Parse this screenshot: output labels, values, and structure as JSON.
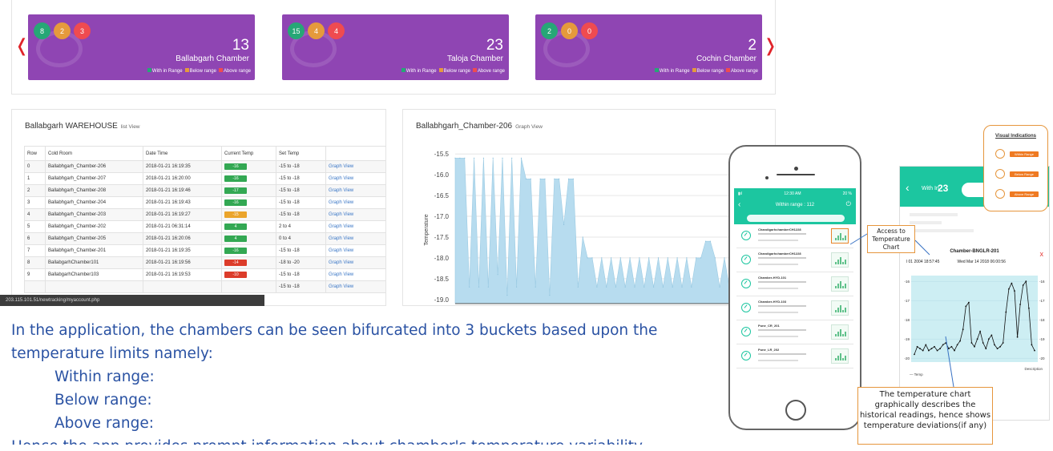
{
  "dashboard": {
    "prev_arrow": "❬",
    "next_arrow": "❭",
    "legend": {
      "within": "With in Range",
      "below": "Below range",
      "above": "Above range"
    },
    "colors": {
      "card_bg": "#8f45b3",
      "within": "#26a776",
      "below": "#e59a3c",
      "above": "#ef4b50"
    },
    "cards": [
      {
        "within": "8",
        "below": "2",
        "above": "3",
        "total": "13",
        "name": "Ballabgarh Chamber"
      },
      {
        "within": "15",
        "below": "4",
        "above": "4",
        "total": "23",
        "name": "Taloja Chamber"
      },
      {
        "within": "2",
        "below": "0",
        "above": "0",
        "total": "2",
        "name": "Cochin Chamber"
      }
    ],
    "warehouse": {
      "title": "Ballabgarh WAREHOUSE",
      "view": "list View",
      "headers": [
        "Row",
        "Cold Room",
        "Date Time",
        "Current Temp",
        "Set Temp",
        ""
      ],
      "rows": [
        {
          "row": "0",
          "room": "Ballabhgarh_Chamber-206",
          "time": "2018-01-21 16:19:35",
          "temp": "-16",
          "status": "g",
          "set": "-15 to -18",
          "link": "Graph View"
        },
        {
          "row": "1",
          "room": "Ballabhgarh_Chamber-207",
          "time": "2018-01-21 16:20:00",
          "temp": "-16",
          "status": "g",
          "set": "-15 to -18",
          "link": "Graph View"
        },
        {
          "row": "2",
          "room": "Ballabhgarh_Chamber-208",
          "time": "2018-01-21 16:19:46",
          "temp": "-17",
          "status": "g",
          "set": "-15 to -18",
          "link": "Graph View"
        },
        {
          "row": "3",
          "room": "Ballabhgarh_Chamber-204",
          "time": "2018-01-21 16:19:43",
          "temp": "-16",
          "status": "g",
          "set": "-15 to -18",
          "link": "Graph View"
        },
        {
          "row": "4",
          "room": "Ballabhgarh_Chamber-203",
          "time": "2018-01-21 16:19:27",
          "temp": "-15",
          "status": "o",
          "set": "-15 to -18",
          "link": "Graph View"
        },
        {
          "row": "5",
          "room": "Ballabhgarh_Chamber-202",
          "time": "2018-01-21 06:31:14",
          "temp": "4",
          "status": "g",
          "set": "2 to 4",
          "link": "Graph View"
        },
        {
          "row": "6",
          "room": "Ballabhgarh_Chamber-205",
          "time": "2018-01-21 16:20:06",
          "temp": "4",
          "status": "g",
          "set": "0 to 4",
          "link": "Graph View"
        },
        {
          "row": "7",
          "room": "Ballabhgarh_Chamber-201",
          "time": "2018-01-21 16:19:35",
          "temp": "-16",
          "status": "g",
          "set": "-15 to -18",
          "link": "Graph View"
        },
        {
          "row": "8",
          "room": "BallabgarhChamber101",
          "time": "2018-01-21 16:19:56",
          "temp": "-14",
          "status": "r",
          "set": "-18 to -20",
          "link": "Graph View"
        },
        {
          "row": "9",
          "room": "BallabgarhChamber103",
          "time": "2018-01-21 16:19:53",
          "temp": "-10",
          "status": "r",
          "set": "-15 to -18",
          "link": "Graph View"
        },
        {
          "row": "",
          "room": "",
          "time": "",
          "temp": "",
          "status": "",
          "set": "-15 to -18",
          "link": "Graph View"
        }
      ]
    },
    "status_url": "203.115.101.51/newtracking/myaccount.php",
    "graph": {
      "title": "Ballabhgarh_Chamber-206",
      "view": "Graph View"
    }
  },
  "chart_data": [
    {
      "type": "area",
      "title": "Ballabhgarh_Chamber-206",
      "ylabel": "Temperature",
      "xlabel": "",
      "ylim": [
        -19.1,
        -15.4
      ],
      "yticks": [
        "-15.5",
        "-16.0",
        "-16.5",
        "-17.0",
        "-17.5",
        "-18.0",
        "-18.5",
        "-19.0"
      ],
      "series": [
        {
          "values": [
            -15.6,
            -15.6,
            -15.6,
            -18.7,
            -15.6,
            -18.7,
            -15.6,
            -18.7,
            -15.6,
            -18.4,
            -15.6,
            -18.9,
            -15.6,
            -18.7,
            -15.6,
            -16.1,
            -16.1,
            -18.7,
            -16.1,
            -16.1,
            -18.9,
            -16.1,
            -16.1,
            -17.2,
            -16.1,
            -16.1,
            -18.7,
            -17.5,
            -18.0,
            -18.0,
            -18.7,
            -18.0,
            -18.7,
            -18.0,
            -18.7,
            -18.0,
            -18.7,
            -18.0,
            -18.7,
            -18.0,
            -18.7,
            -18.0,
            -18.7,
            -18.0,
            -18.7,
            -18.0,
            -18.7,
            -18.0,
            -18.7,
            -18.0,
            -18.7,
            -18.0,
            -18.0,
            -17.6,
            -17.6,
            -18.0,
            -18.7,
            -18.0,
            -18.7,
            -18.0,
            -18.7,
            -18.0,
            -18.7,
            -18.0,
            -18.7,
            -18.0,
            -18.7,
            -18.0
          ]
        }
      ]
    },
    {
      "type": "line",
      "title": "Chamber-BNGLR-201",
      "xlabel": "Description",
      "ylabel": "",
      "ylim": [
        -20.2,
        -15.7
      ],
      "yticks": [
        "-16",
        "-17",
        "-18",
        "-19",
        "-20"
      ],
      "series": [
        {
          "name": "Temp",
          "values": [
            -19.8,
            -19.4,
            -19.5,
            -19.6,
            -19.3,
            -19.6,
            -19.5,
            -19.4,
            -19.6,
            -19.5,
            -19.3,
            -19.2,
            -19.5,
            -19.4,
            -19.6,
            -19.3,
            -19.1,
            -18.5,
            -17.3,
            -17.1,
            -19.2,
            -19.4,
            -19.0,
            -18.6,
            -19.2,
            -19.5,
            -19.0,
            -18.8,
            -19.3,
            -19.5,
            -19.4,
            -19.2,
            -17.6,
            -16.4,
            -16.1,
            -16.5,
            -18.9,
            -17.2,
            -16.2,
            -16.0,
            -17.4,
            -19.3,
            -19.6
          ]
        }
      ]
    }
  ],
  "description": {
    "line1": "In the application, the chambers can be seen bifurcated into 3 buckets based upon the",
    "line2": "temperature limits namely:",
    "within": "Within range:",
    "below": "Below range:",
    "above": "Above range:",
    "line6": "Hence the app provides prompt information about chamber's temperature variability"
  },
  "phone": {
    "time": "12:30 AM",
    "battery": "20 %",
    "title": "Within range : 112",
    "items": [
      {
        "name": "ChandigarhchamberCH1228"
      },
      {
        "name": "ChandigarhchamberCH1228"
      },
      {
        "name": "Chamber-HYD-101"
      },
      {
        "name": "Chamber-HYD-103"
      },
      {
        "name": "Pune_CR_201"
      },
      {
        "name": "Pune_LR_202"
      }
    ]
  },
  "callouts": {
    "access": "Access to Temperature Chart",
    "temp_chart": "The temperature chart graphically describes the historical readings, hence shows temperature deviations(if any)"
  },
  "android": {
    "status_time": "12:34 PM",
    "within_label": "With In",
    "within_count": "23",
    "chart_title": "Chamber-BNGLR-201",
    "date_from": "l 01 2004 18:57:45",
    "date_to": "Wed Mar 14 2018 06:00:56",
    "legend": "— Temp",
    "close": "x"
  },
  "visual_indications": {
    "title": "Visual Indications",
    "items": [
      "Within Range",
      "Below Range",
      "Above Range"
    ]
  }
}
